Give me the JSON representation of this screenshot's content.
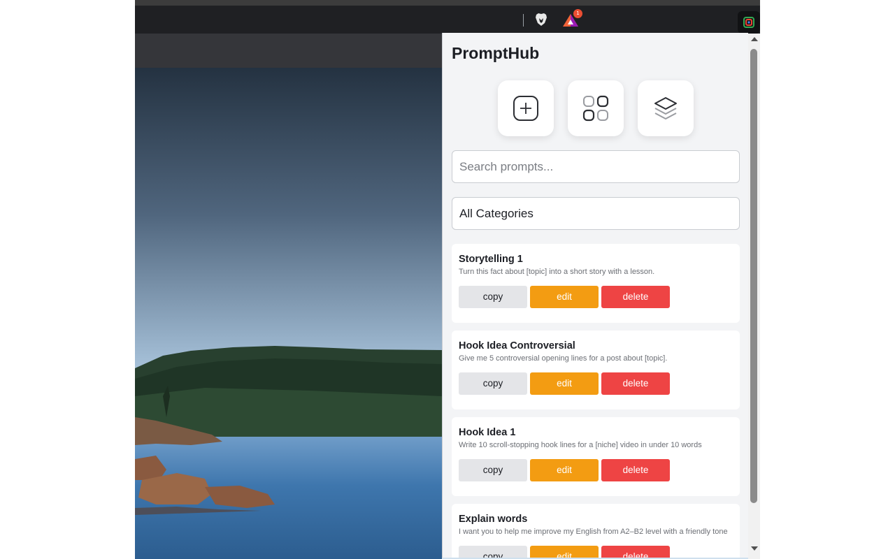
{
  "app": {
    "title": "PromptHub"
  },
  "toolbar": {
    "icons": [
      "brave-shield-icon",
      "brave-rewards-icon",
      "extension-icon"
    ],
    "rewards_badge": "1"
  },
  "actions": [
    {
      "name": "add-prompt",
      "icon": "plus-square-icon"
    },
    {
      "name": "categories",
      "icon": "grid-icon"
    },
    {
      "name": "collections",
      "icon": "layers-icon"
    }
  ],
  "search": {
    "placeholder": "Search prompts...",
    "value": ""
  },
  "category_filter": {
    "selected": "All Categories"
  },
  "buttons": {
    "copy": "copy",
    "edit": "edit",
    "delete": "delete"
  },
  "prompts": [
    {
      "title": "Storytelling 1",
      "description": "Turn this fact about [topic] into a short story with a lesson."
    },
    {
      "title": "Hook Idea Controversial",
      "description": "Give me 5 controversial opening lines for a post about [topic]."
    },
    {
      "title": "Hook Idea 1",
      "description": "Write 10 scroll-stopping hook lines for a [niche] video in under 10 words"
    },
    {
      "title": "Explain words",
      "description": "I want you to help me improve my English from A2–B2 level with a friendly tone"
    }
  ],
  "colors": {
    "edit": "#f39c12",
    "delete": "#ee4444",
    "copy": "#e4e5e8",
    "popup_bg": "#f3f4f6"
  }
}
